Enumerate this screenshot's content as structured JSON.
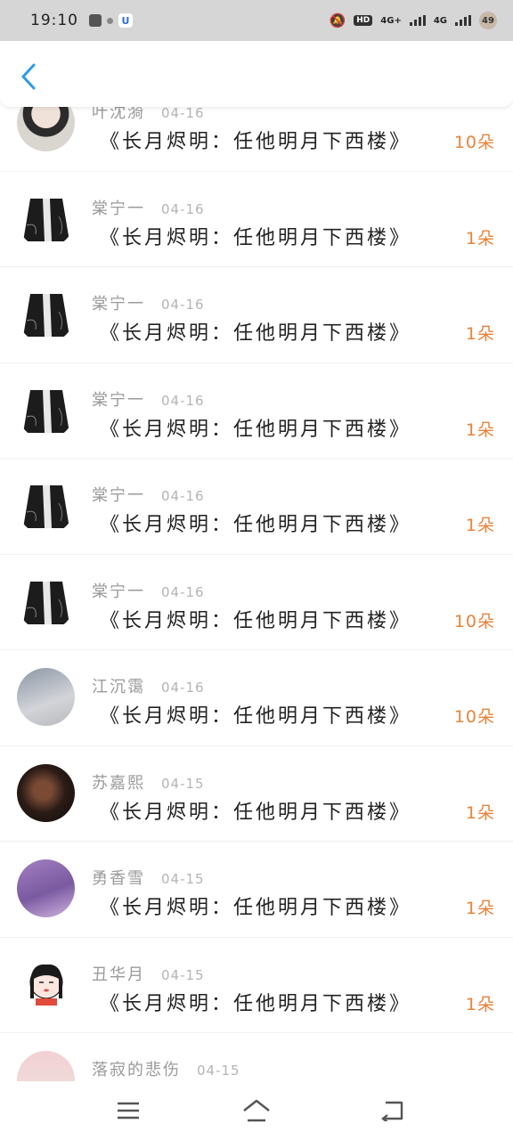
{
  "status_bar": {
    "time": "19:10",
    "network_1": "4G+",
    "network_2": "4G",
    "battery": "49"
  },
  "header": {
    "back_icon": "chevron-left-icon",
    "accent_color": "#2e9be6"
  },
  "gift_list": {
    "count_color": "#e8833a",
    "items": [
      {
        "username": "叶沈漪",
        "date": "04-16",
        "gift": "《长月烬明：任他明月下西楼》",
        "count": "10朵",
        "avatar": "avatar-girl-photo"
      },
      {
        "username": "棠宁一",
        "date": "04-16",
        "gift": "《长月烬明：任他明月下西楼》",
        "count": "1朵",
        "avatar": "avatar-black-robe"
      },
      {
        "username": "棠宁一",
        "date": "04-16",
        "gift": "《长月烬明：任他明月下西楼》",
        "count": "1朵",
        "avatar": "avatar-black-robe"
      },
      {
        "username": "棠宁一",
        "date": "04-16",
        "gift": "《长月烬明：任他明月下西楼》",
        "count": "1朵",
        "avatar": "avatar-black-robe"
      },
      {
        "username": "棠宁一",
        "date": "04-16",
        "gift": "《长月烬明：任他明月下西楼》",
        "count": "1朵",
        "avatar": "avatar-black-robe"
      },
      {
        "username": "棠宁一",
        "date": "04-16",
        "gift": "《长月烬明：任他明月下西楼》",
        "count": "10朵",
        "avatar": "avatar-black-robe"
      },
      {
        "username": "江沉霭",
        "date": "04-16",
        "gift": "《长月烬明：任他明月下西楼》",
        "count": "10朵",
        "avatar": "avatar-girl-dress"
      },
      {
        "username": "苏嘉熙",
        "date": "04-15",
        "gift": "《长月烬明：任他明月下西楼》",
        "count": "1朵",
        "avatar": "avatar-dark-photo"
      },
      {
        "username": "勇香雪",
        "date": "04-15",
        "gift": "《长月烬明：任他明月下西楼》",
        "count": "1朵",
        "avatar": "avatar-purple-girl"
      },
      {
        "username": "丑华月",
        "date": "04-15",
        "gift": "《长月烬明：任他明月下西楼》",
        "count": "1朵",
        "avatar": "avatar-cartoon-girl"
      },
      {
        "username": "落寂的悲伤",
        "date": "04-15",
        "gift": "",
        "count": "",
        "avatar": "avatar-pink-photo"
      }
    ]
  },
  "bottom_nav": {
    "menu_icon": "menu-icon",
    "home_icon": "home-icon",
    "back_icon": "back-arrow-icon"
  }
}
